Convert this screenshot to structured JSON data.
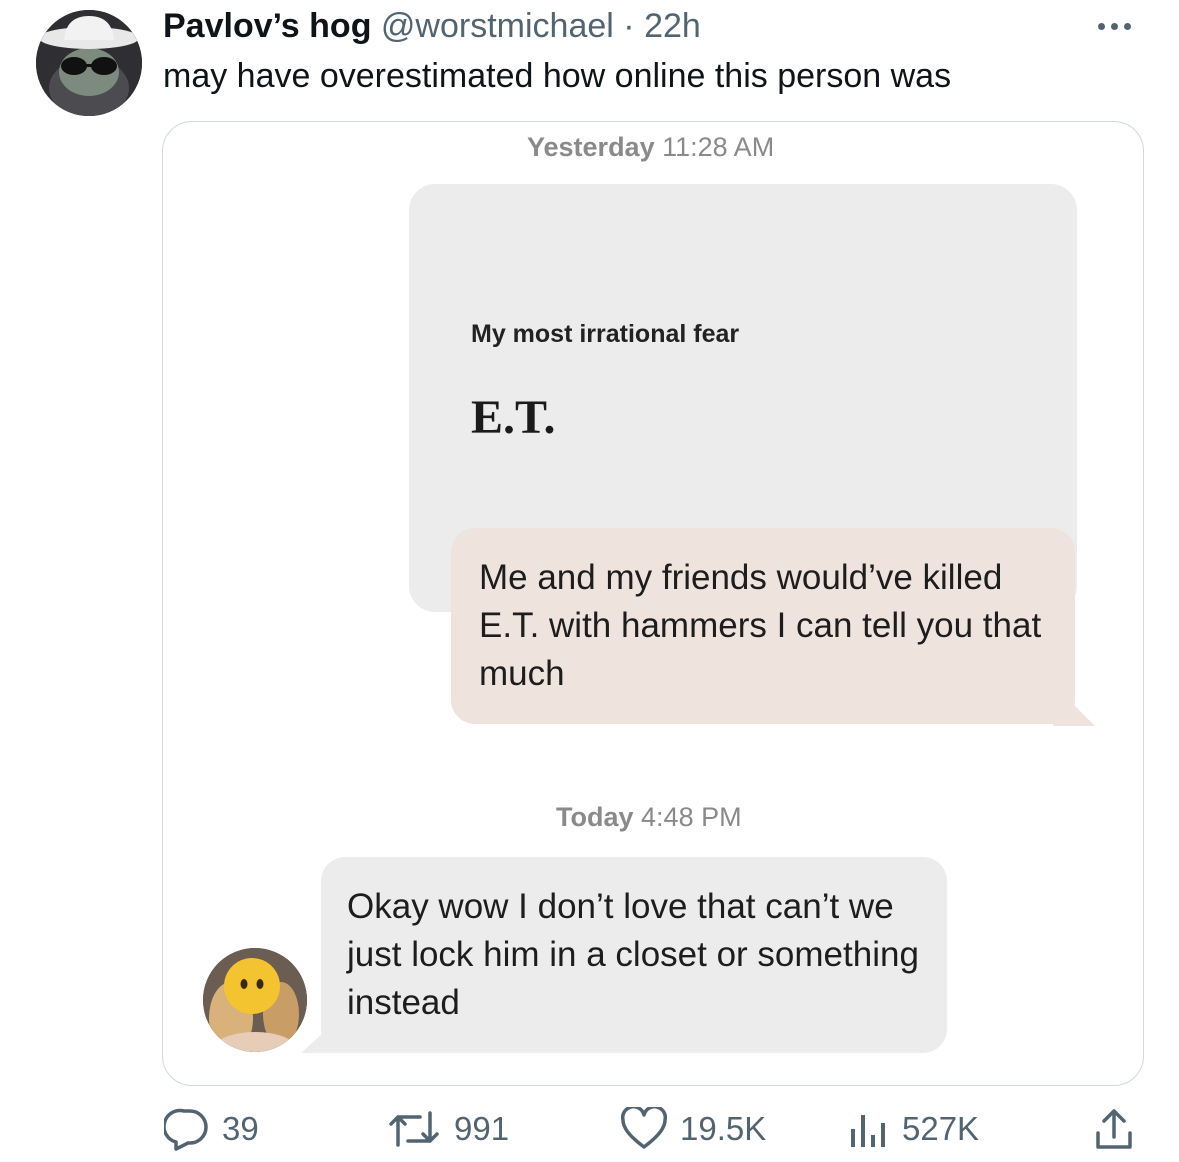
{
  "author": {
    "display_name": "Pavlov’s hog",
    "handle": "@worstmichael",
    "separator": "·",
    "time": "22h"
  },
  "tweet_text": "may have overestimated how online this person was",
  "more_icon": "more-dots-icon",
  "media": {
    "timestamp_1": {
      "day": "Yesterday",
      "time": "11:28 AM"
    },
    "prompt_card": {
      "label": "My most irrational fear",
      "answer": "E.T."
    },
    "outgoing_message": "Me and my friends would’ve killed E.T. with hammers I can tell you that much",
    "timestamp_2": {
      "day": "Today",
      "time": "4:48 PM"
    },
    "incoming_message": "Okay wow I don’t love that can’t we just lock him in a closet or something instead",
    "sender_avatar_icon": "smiley-face-icon"
  },
  "actions": {
    "replies": {
      "icon": "reply-icon",
      "count": "39"
    },
    "reposts": {
      "icon": "repost-icon",
      "count": "991"
    },
    "likes": {
      "icon": "heart-icon",
      "count": "19.5K"
    },
    "views": {
      "icon": "views-icon",
      "count": "527K"
    },
    "share": {
      "icon": "share-icon"
    }
  },
  "colors": {
    "secondary_text": "#536471",
    "outgoing_bubble": "#efe3de",
    "incoming_bubble": "#ececec",
    "emoji_yellow": "#f4c430"
  }
}
